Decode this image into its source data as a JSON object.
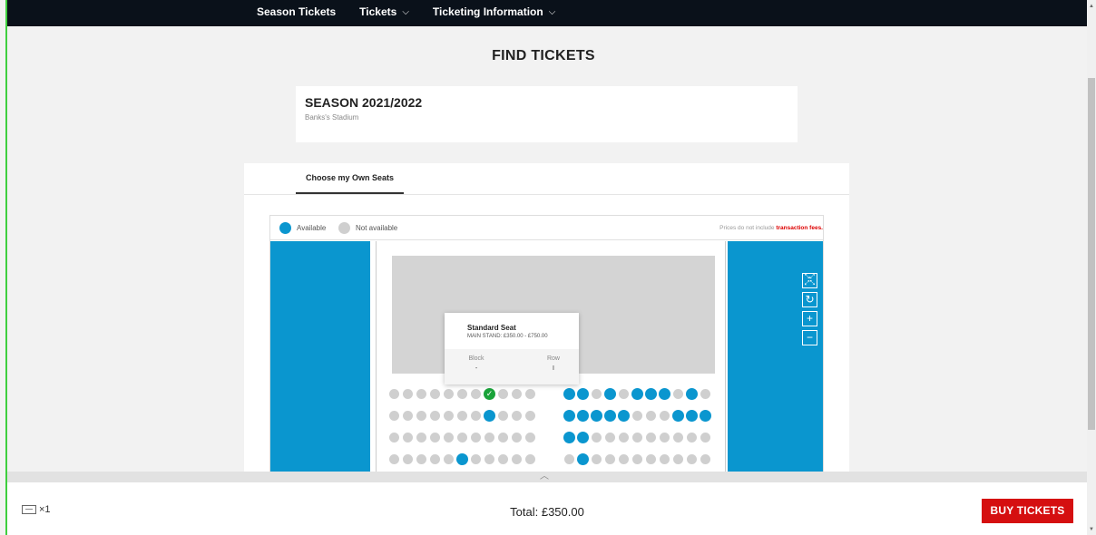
{
  "nav": {
    "items": [
      {
        "label": "Season Tickets",
        "has_dropdown": false
      },
      {
        "label": "Tickets",
        "has_dropdown": true
      },
      {
        "label": "Ticketing Information",
        "has_dropdown": true
      }
    ]
  },
  "page": {
    "title": "FIND TICKETS"
  },
  "season": {
    "title": "SEASON 2021/2022",
    "venue": "Banks's Stadium"
  },
  "tabs": [
    {
      "label": "Choose my Own Seats",
      "active": true
    }
  ],
  "legend": {
    "available_label": "Available",
    "unavailable_label": "Not available",
    "note_prefix": "Prices do not include ",
    "note_link": "transaction fees."
  },
  "tooltip": {
    "title": "Standard Seat",
    "subtitle": "MAIN STAND: £350.00 - £750.00",
    "block_label": "Block",
    "block_value": "-",
    "row_label": "Row",
    "row_value": "I"
  },
  "zoom_controls": [
    "fullscreen-icon",
    "reset-icon",
    "zoom-in-icon",
    "zoom-out-icon"
  ],
  "seat_rows_left": [
    "uuuuuuusuuu",
    "uuuuuuuauuu",
    "uuuuuuuuuuu",
    "uuuuuauuuuu"
  ],
  "seat_rows_right": [
    "aauauaaauau",
    "aaaaauuuaaa",
    "aauuuuuuuuu",
    "uauuuuuuuuu"
  ],
  "footer": {
    "ticket_count": "×1",
    "total": "Total: £350.00",
    "buy_label": "BUY TICKETS"
  },
  "colors": {
    "available": "#0a96cf",
    "unavailable": "#cfcfcf",
    "selected": "#1aa33a",
    "buy_button": "#d50f10",
    "nav_bg": "#0a111a"
  }
}
